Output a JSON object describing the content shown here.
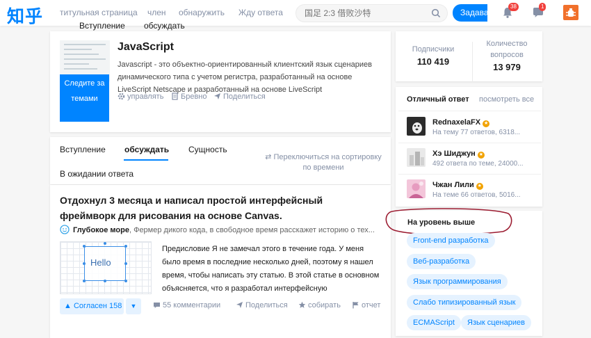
{
  "header": {
    "logo": "知乎",
    "nav": [
      "титульная страница",
      "член",
      "обнаружить",
      "Жду ответа"
    ],
    "nav_sub": [
      "Вступление",
      "обсуждать"
    ],
    "search_placeholder": "国足 2:3 借败沙特",
    "ask_label": "Задавать",
    "notifications_count": "38",
    "messages_count": "1",
    "accent": "#0084ff"
  },
  "topic": {
    "title": "JavaScript",
    "description": "Javascript - это объектно-ориентированный клиентский язык сценариев динамического типа с учетом регистра, разработанный на основе LiveScript Netscape и разработанный на основе LiveScript",
    "follow_label": "Следите за темами",
    "actions": [
      "управлять",
      "Бревно",
      "Поделиться"
    ]
  },
  "tabs": {
    "items": [
      "Вступление",
      "обсуждать",
      "Сущность"
    ],
    "active": "обсуждать",
    "sort_link": "⇄ Переключиться на сортировку по времени",
    "waiting": "В ожидании ответа"
  },
  "feed": {
    "title": "Отдохнул 3 месяца и написал простой интерфейсный фреймворк для рисования на основе Canvas.",
    "author": "Глубокое море",
    "author_bio": ", Фермер дикого кода, в свободное время расскажет историю о тех...",
    "preview_text": "Hello",
    "excerpt": "Предисловие Я не замечал этого в течение года. У меня было время в последние несколько дней, поэтому я нашел время, чтобы написать эту статью. В этой статье в основном объясняется, что я разработал интерфейсную",
    "vote_label": "▲ Согласен 158",
    "vote_down": "▼",
    "actions": {
      "comments": "55 комментарии",
      "share": "Поделиться",
      "collect": "собирать",
      "report": "отчет"
    }
  },
  "stats": {
    "followers_label": "Подписчики",
    "followers_value": "110 419",
    "questions_label": "Количество вопросов",
    "questions_value": "13 979"
  },
  "best_answerers": {
    "title": "Отличный ответ",
    "more": "посмотреть все",
    "people": [
      {
        "name": "RednaxelaFX",
        "sub": "На тему 77 ответов, 6318..."
      },
      {
        "name": "Хэ Шиджун",
        "sub": "492 ответа по теме, 24000..."
      },
      {
        "name": "Чжан Лили",
        "sub": "На теме 66 ответов, 5016..."
      }
    ]
  },
  "parent_topics": {
    "title": "На уровень выше",
    "tags": [
      "Front-end разработка",
      "Веб-разработка",
      "Язык программирования",
      "Слабо типизированный язык",
      "ECMAScript",
      "Язык сценариев"
    ]
  }
}
